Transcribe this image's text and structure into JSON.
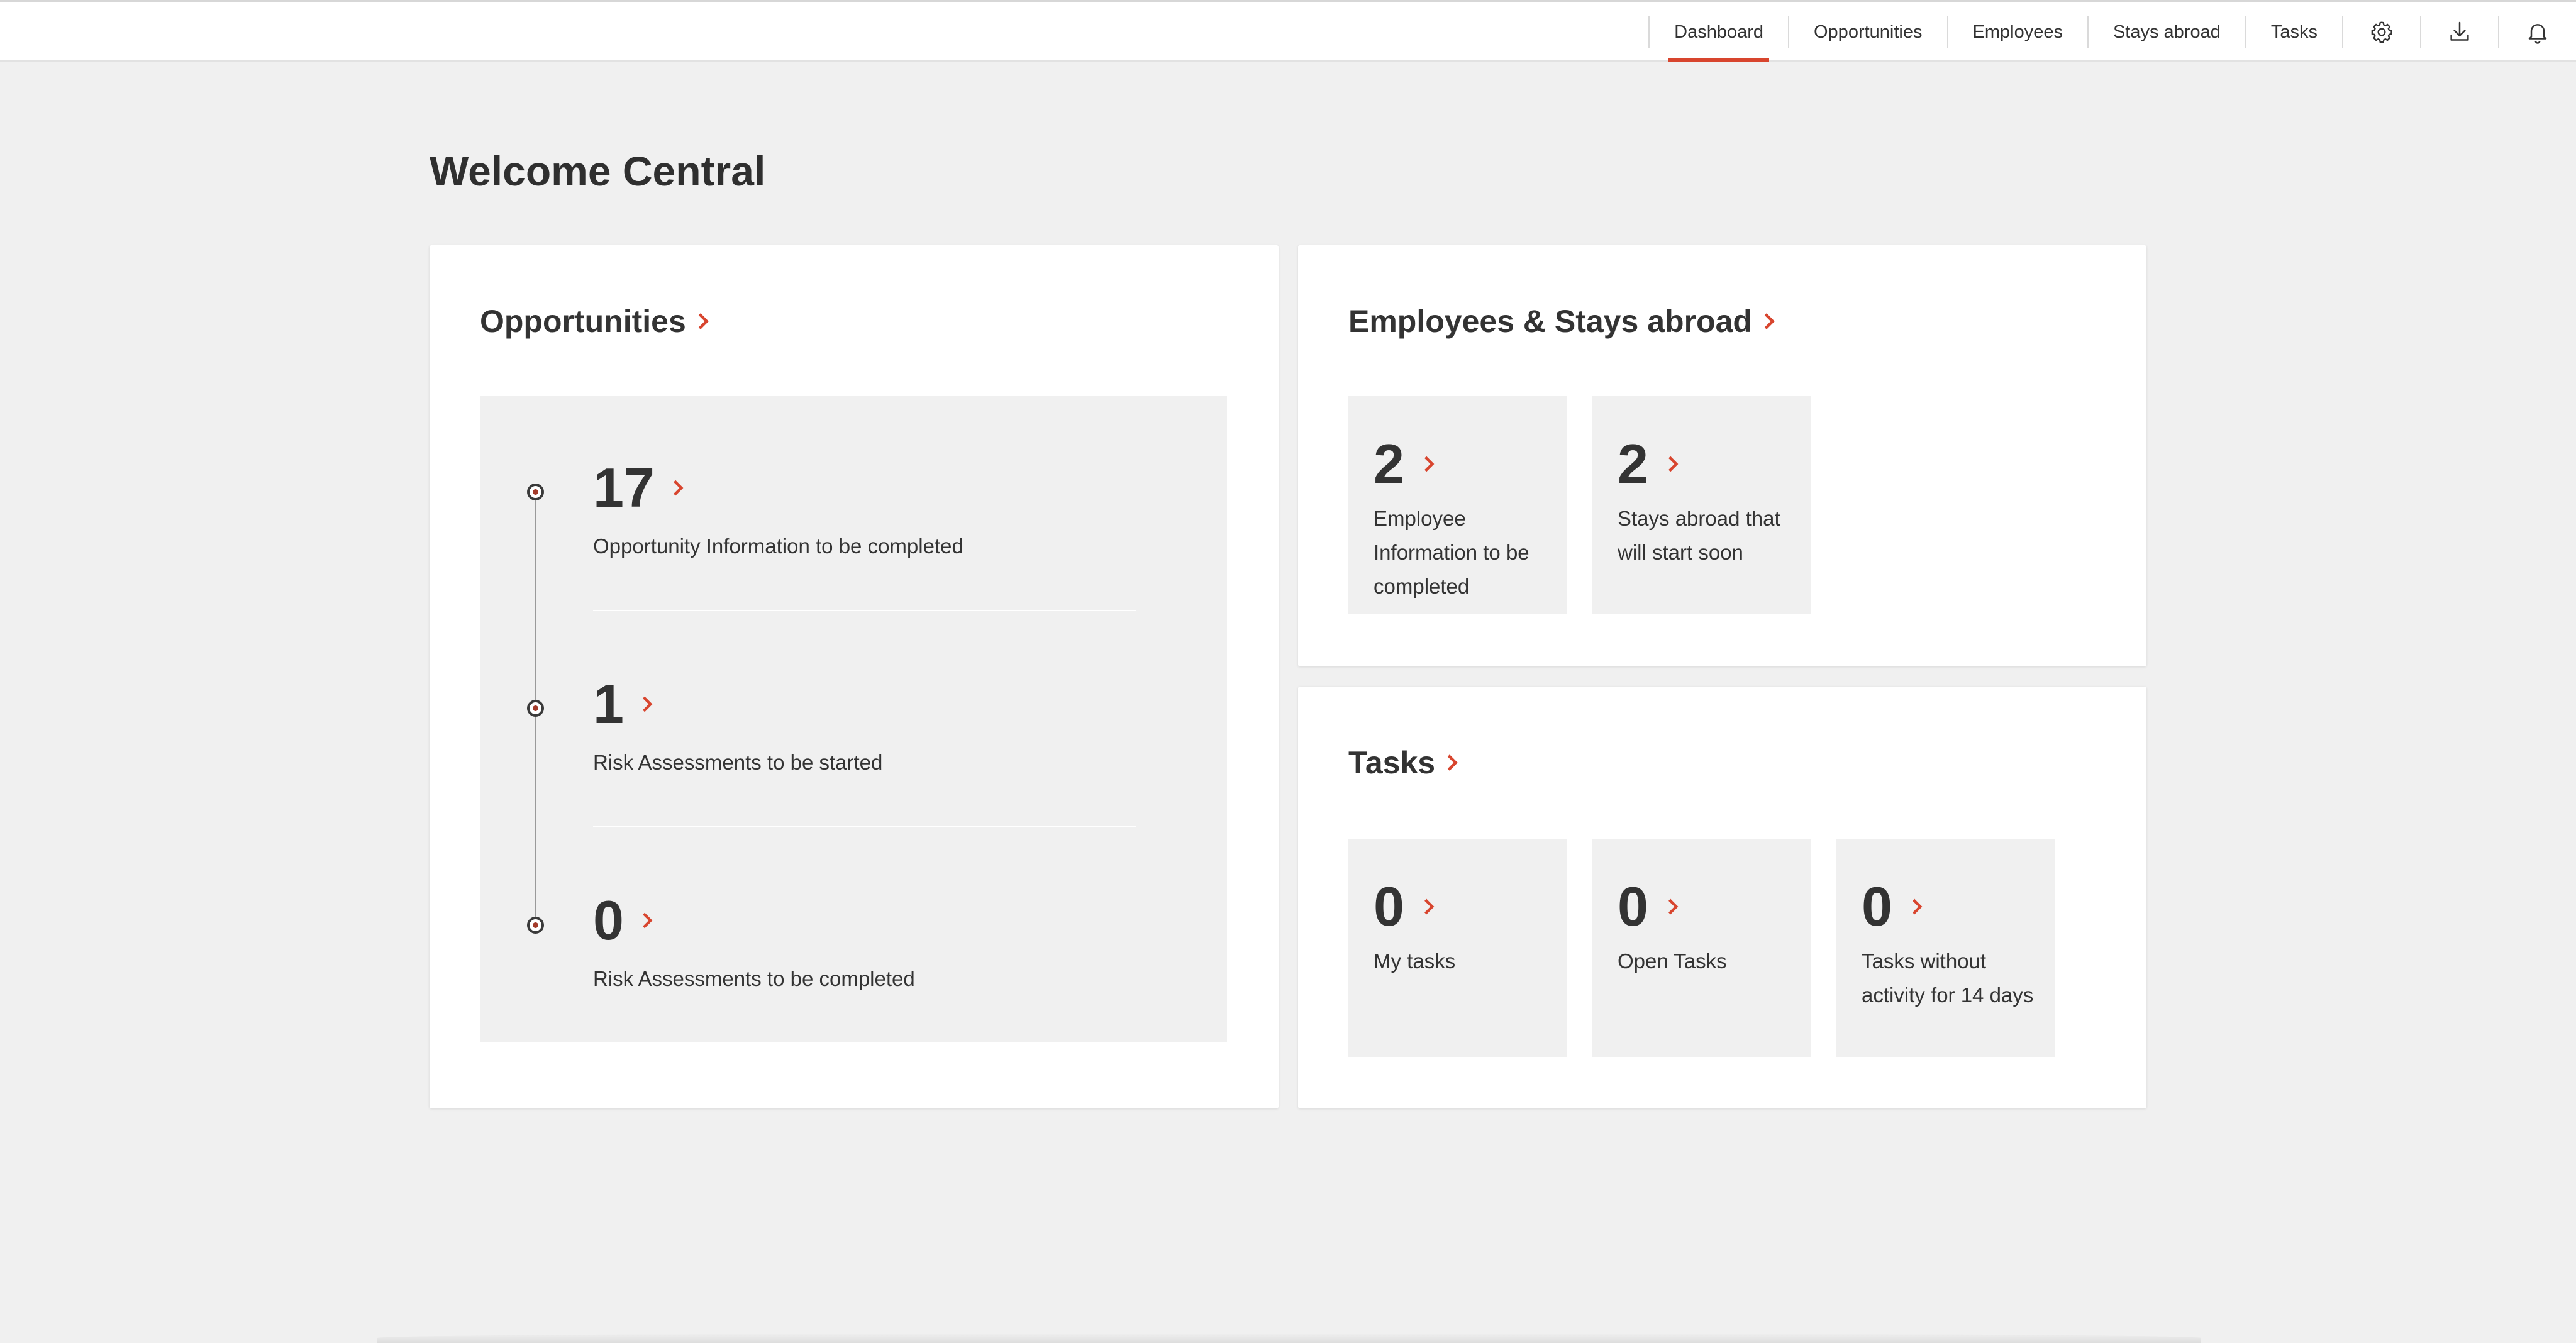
{
  "nav": {
    "items": [
      {
        "label": "Dashboard",
        "active": true
      },
      {
        "label": "Opportunities",
        "active": false
      },
      {
        "label": "Employees",
        "active": false
      },
      {
        "label": "Stays abroad",
        "active": false
      },
      {
        "label": "Tasks",
        "active": false
      }
    ],
    "icons": [
      "gear-icon",
      "download-icon",
      "bell-icon"
    ]
  },
  "page": {
    "title": "Welcome Central"
  },
  "opportunities": {
    "title": "Opportunities",
    "rows": [
      {
        "count": "17",
        "label": "Opportunity Information to be completed"
      },
      {
        "count": "1",
        "label": "Risk Assessments to be started"
      },
      {
        "count": "0",
        "label": "Risk Assessments to be completed"
      }
    ]
  },
  "employees": {
    "title": "Employees & Stays abroad",
    "tiles": [
      {
        "count": "2",
        "label": "Employee Information to be completed"
      },
      {
        "count": "2",
        "label": "Stays abroad that will start soon"
      }
    ]
  },
  "tasks": {
    "title": "Tasks",
    "tiles": [
      {
        "count": "0",
        "label": "My tasks"
      },
      {
        "count": "0",
        "label": "Open Tasks"
      },
      {
        "count": "0",
        "label": "Tasks without activity for 14 days"
      }
    ]
  },
  "colors": {
    "accent": "#d8452e",
    "background": "#f0f0f0",
    "card": "#ffffff",
    "text": "#333333"
  }
}
